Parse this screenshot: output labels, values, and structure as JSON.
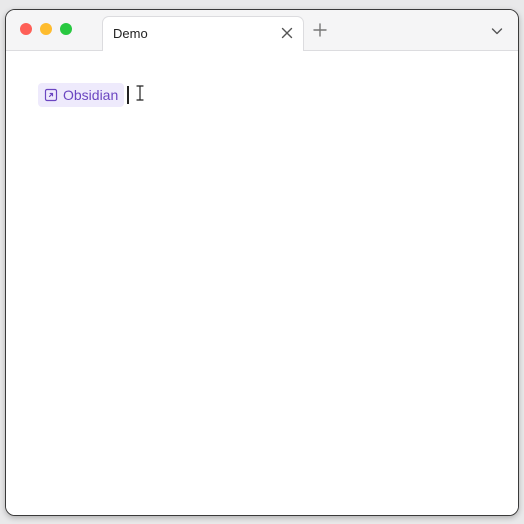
{
  "window": {
    "tab": {
      "title": "Demo"
    }
  },
  "editor": {
    "link": {
      "label": "Obsidian",
      "icon": "external-link-icon"
    }
  },
  "icons": {
    "tab_close": "close-icon",
    "new_tab": "plus-icon",
    "tab_list": "chevron-down-icon",
    "cursor": "i-beam-cursor-icon"
  },
  "colors": {
    "close": "#fe5f57",
    "minimize": "#febc2e",
    "maximize": "#28c840",
    "link_text": "#6b46c1",
    "link_background": "#eeeafc"
  }
}
